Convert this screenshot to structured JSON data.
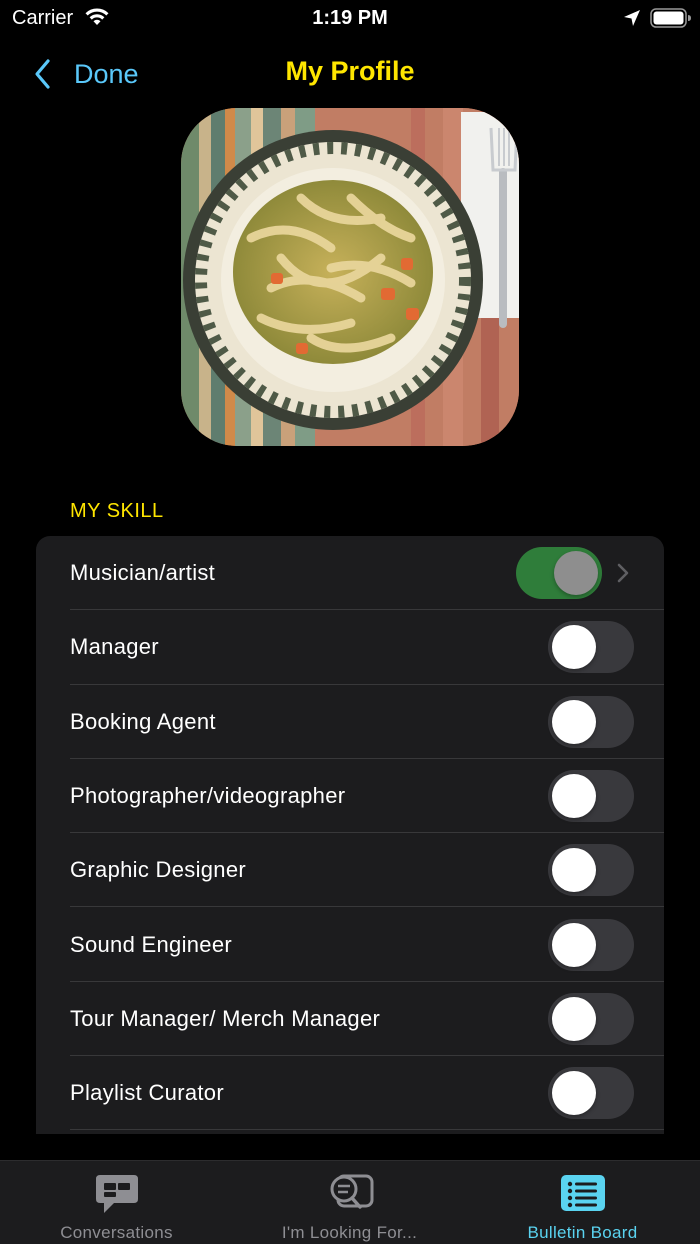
{
  "status_bar": {
    "carrier": "Carrier",
    "time": "1:19 PM"
  },
  "nav": {
    "back_label": "Done",
    "title": "My Profile"
  },
  "profile": {
    "photo_alt": "Profile photo"
  },
  "skills": {
    "header": "MY SKILL",
    "items": [
      {
        "label": "Musician/artist",
        "enabled": true,
        "has_disclosure": true
      },
      {
        "label": "Manager",
        "enabled": false
      },
      {
        "label": "Booking Agent",
        "enabled": false
      },
      {
        "label": "Photographer/videographer",
        "enabled": false
      },
      {
        "label": "Graphic Designer",
        "enabled": false
      },
      {
        "label": "Sound Engineer",
        "enabled": false
      },
      {
        "label": "Tour Manager/ Merch Manager",
        "enabled": false
      },
      {
        "label": "Playlist Curator",
        "enabled": false
      }
    ]
  },
  "tab_bar": {
    "tabs": [
      {
        "label": "Conversations",
        "icon": "chat-bubble-icon",
        "active": false
      },
      {
        "label": "I'm Looking For...",
        "icon": "search-bubble-icon",
        "active": false
      },
      {
        "label": "Bulletin Board",
        "icon": "list-icon",
        "active": true
      }
    ]
  },
  "colors": {
    "accent_yellow": "#ffe600",
    "accent_blue": "#5ac8fa",
    "toggle_on": "#2f7d3a",
    "tab_active": "#5ad3f0"
  }
}
